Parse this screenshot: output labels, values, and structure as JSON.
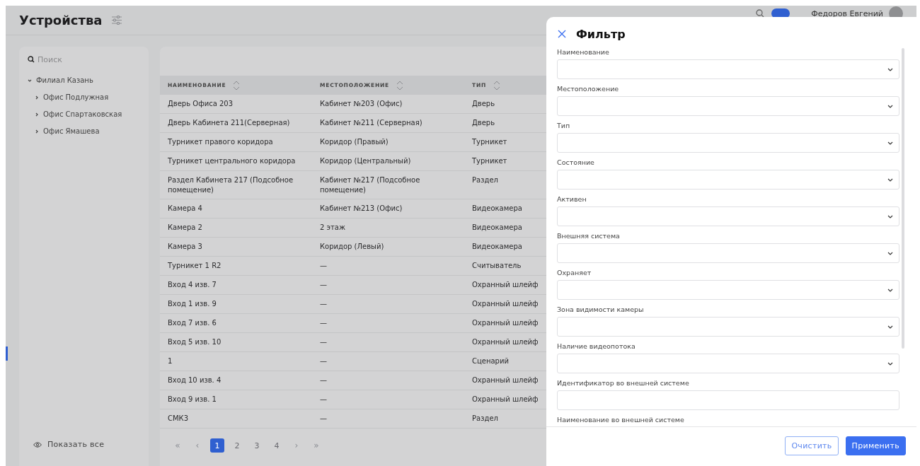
{
  "page": {
    "title": "Устройства"
  },
  "top_bar": {
    "toggle": {
      "on": true
    },
    "user_name": "Федоров Евгений"
  },
  "sidebar": {
    "search": {
      "placeholder": "Поиск"
    },
    "tree": [
      {
        "label": "Филиал Казань",
        "expanded": true,
        "children": [
          {
            "label": "Офис Подлужная",
            "expanded": false
          },
          {
            "label": "Офис Спартаковская",
            "expanded": false
          },
          {
            "label": "Офис Ямашева",
            "expanded": false
          }
        ]
      }
    ],
    "show_all": "Показать все"
  },
  "table": {
    "columns": [
      "НАИМЕНОВАНИЕ",
      "МЕСТОПОЛОЖЕНИЕ",
      "ТИП"
    ],
    "rows": [
      [
        "Дверь Офиса 203",
        "Кабинет №203 (Офис)",
        "Дверь"
      ],
      [
        "Дверь Кабинета 211(Серверная)",
        "Кабинет №211 (Серверная)",
        "Дверь"
      ],
      [
        "Турникет правого коридора",
        "Коридор (Правый)",
        "Турникет"
      ],
      [
        "Турникет центрального коридора",
        "Коридор (Центральный)",
        "Турникет"
      ],
      [
        "Раздел Кабинета 217 (Подсобное помещение)",
        "Кабинет №217 (Подсобное помещение)",
        "Раздел"
      ],
      [
        "Камера 4",
        "Кабинет №213 (Офис)",
        "Видеокамера"
      ],
      [
        "Камера 2",
        "2 этаж",
        "Видеокамера"
      ],
      [
        "Камера 3",
        "Коридор (Левый)",
        "Видеокамера"
      ],
      [
        "Турникет 1 R2",
        "—",
        "Считыватель"
      ],
      [
        "Вход 4 изв. 7",
        "—",
        "Охранный шлейф"
      ],
      [
        "Вход 1 изв. 9",
        "—",
        "Охранный шлейф"
      ],
      [
        "Вход 7 изв. 6",
        "—",
        "Охранный шлейф"
      ],
      [
        "Вход 5 изв. 10",
        "—",
        "Охранный шлейф"
      ],
      [
        "1",
        "—",
        "Сценарий"
      ],
      [
        "Вход 10 изв. 4",
        "—",
        "Охранный шлейф"
      ],
      [
        "Вход 9 изв. 1",
        "—",
        "Охранный шлейф"
      ],
      [
        "СМК3",
        "—",
        "Раздел"
      ]
    ]
  },
  "pagination": [
    {
      "label": "«",
      "kind": "nav",
      "selected": false
    },
    {
      "label": "‹",
      "kind": "nav",
      "selected": false
    },
    {
      "label": "1",
      "kind": "page",
      "selected": true
    },
    {
      "label": "2",
      "kind": "page",
      "selected": false
    },
    {
      "label": "3",
      "kind": "page",
      "selected": false
    },
    {
      "label": "4",
      "kind": "page",
      "selected": false
    },
    {
      "label": "›",
      "kind": "nav",
      "selected": false
    },
    {
      "label": "»",
      "kind": "nav",
      "selected": false
    }
  ],
  "filter": {
    "title": "Фильтр",
    "fields": [
      {
        "label": "Наименование",
        "kind": "select"
      },
      {
        "label": "Местоположение",
        "kind": "select"
      },
      {
        "label": "Тип",
        "kind": "select"
      },
      {
        "label": "Состояние",
        "kind": "select"
      },
      {
        "label": "Активен",
        "kind": "select"
      },
      {
        "label": "Внешняя система",
        "kind": "select"
      },
      {
        "label": "Охраняет",
        "kind": "select"
      },
      {
        "label": "Зона видимости камеры",
        "kind": "select"
      },
      {
        "label": "Наличие видеопотока",
        "kind": "select"
      },
      {
        "label": "Идентификатор во внешней системе",
        "kind": "text"
      },
      {
        "label": "Наименование во внешней системе"
      }
    ],
    "buttons": [
      {
        "label": "Очистить",
        "kind": "secondary"
      },
      {
        "label": "Применить",
        "kind": "primary"
      }
    ]
  }
}
